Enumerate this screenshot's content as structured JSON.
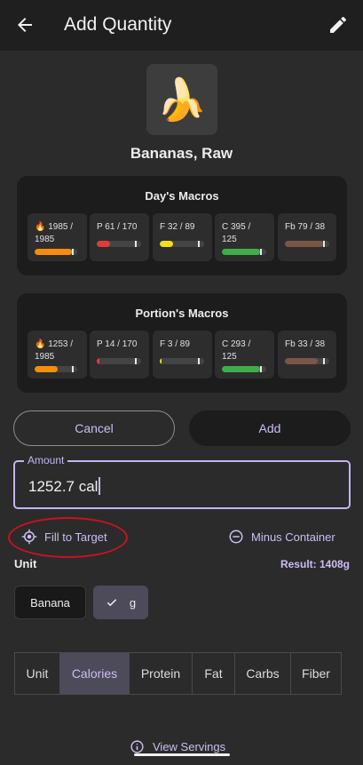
{
  "appbar": {
    "title": "Add Quantity"
  },
  "food": {
    "emoji": "🍌",
    "name": "Bananas, Raw"
  },
  "days_macros": {
    "title": "Day's Macros",
    "chips": [
      {
        "label": "🔥 1985 /\n1985",
        "fraction": 1.0,
        "color": "#fa8c0a"
      },
      {
        "label": "P 61 / 170",
        "fraction": 0.36,
        "color": "#e03b3b"
      },
      {
        "label": "F 32 / 89",
        "fraction": 0.36,
        "color": "#f5dc1e"
      },
      {
        "label": "C 395 /\n125",
        "fraction": 1.0,
        "color": "#3fae49"
      },
      {
        "label": "Fb 79 / 38",
        "fraction": 1.0,
        "color": "#7a5647"
      }
    ]
  },
  "portion_macros": {
    "title": "Portion's Macros",
    "chips": [
      {
        "label": "🔥 1253 /\n1985",
        "fraction": 0.63,
        "color": "#fa8c0a"
      },
      {
        "label": "P 14 / 170",
        "fraction": 0.08,
        "color": "#e03b3b"
      },
      {
        "label": "F 3 / 89",
        "fraction": 0.03,
        "color": "#f5dc1e"
      },
      {
        "label": "C 293 /\n125",
        "fraction": 1.0,
        "color": "#3fae49"
      },
      {
        "label": "Fb 33 / 38",
        "fraction": 0.87,
        "color": "#7a5647"
      }
    ]
  },
  "actions": {
    "cancel": "Cancel",
    "add": "Add"
  },
  "amount": {
    "label": "Amount",
    "value": "1252.7 cal"
  },
  "fill_to_target": "Fill to Target",
  "minus_container": "Minus Container",
  "unit_label": "Unit",
  "result": "Result: 1408g",
  "units": {
    "banana": "Banana",
    "g": "g"
  },
  "segments": [
    "Unit",
    "Calories",
    "Protein",
    "Fat",
    "Carbs",
    "Fiber"
  ],
  "active_segment": "Calories",
  "view_servings": "View Servings",
  "colors": {
    "accent": "#cdbdf2",
    "annotation": "#c9131f"
  }
}
